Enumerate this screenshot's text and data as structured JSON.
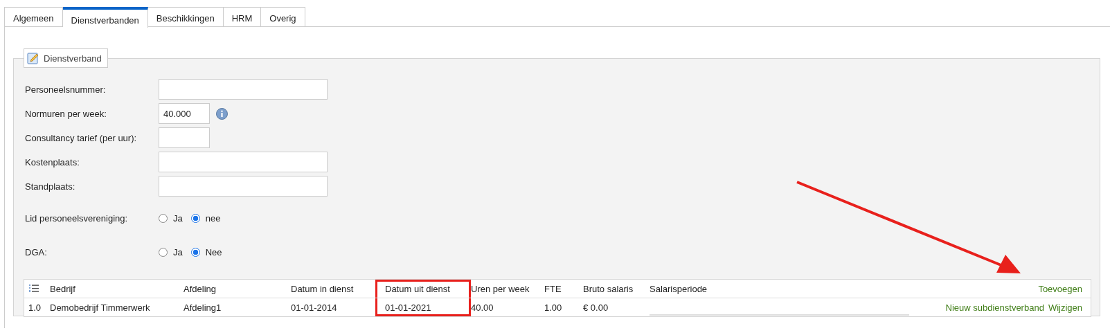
{
  "tabs": [
    {
      "label": "Algemeen",
      "selected": false
    },
    {
      "label": "Dienstverbanden",
      "selected": true
    },
    {
      "label": "Beschikkingen",
      "selected": false
    },
    {
      "label": "HRM",
      "selected": false
    },
    {
      "label": "Overig",
      "selected": false
    }
  ],
  "fieldset": {
    "legend": "Dienstverband",
    "fields": [
      {
        "kind": "wide",
        "label": "Personeelsnummer:"
      },
      {
        "kind": "narrow",
        "label": "Normuren per week:",
        "value": "40.000",
        "info": true
      },
      {
        "kind": "narrow",
        "label": "Consultancy tarief (per uur):"
      },
      {
        "kind": "wide",
        "label": "Kostenplaats:"
      },
      {
        "kind": "wide",
        "label": "Standplaats:"
      },
      {
        "kind": "radio",
        "label": "Lid personeelsvereniging:",
        "options": [
          {
            "label": "Ja",
            "selected": false
          },
          {
            "label": "nee",
            "selected": true
          }
        ]
      },
      {
        "kind": "radio",
        "label": "DGA:",
        "options": [
          {
            "label": "Ja",
            "selected": false
          },
          {
            "label": "Nee",
            "selected": true
          }
        ]
      }
    ]
  },
  "table": {
    "columns": [
      {
        "label": "Bedrijf",
        "highlighted": false
      },
      {
        "label": "Afdeling",
        "highlighted": false
      },
      {
        "label": "Datum in dienst",
        "highlighted": false
      },
      {
        "label": "Datum uit dienst",
        "highlighted": true
      },
      {
        "label": "Uren per week",
        "highlighted": false
      },
      {
        "label": "FTE",
        "highlighted": false
      },
      {
        "label": "Bruto salaris",
        "highlighted": false
      },
      {
        "label": "Salarisperiode",
        "highlighted": false
      }
    ],
    "add_link": "Toevoegen",
    "rows": [
      {
        "number": "1.0",
        "cells": [
          "Demobedrijf Timmerwerk",
          "Afdeling1",
          "01-01-2014",
          "01-01-2021",
          "40.00",
          "1.00",
          "€ 0.00",
          ""
        ],
        "links": [
          "Nieuw subdienstverband",
          "Wijzigen"
        ]
      }
    ]
  }
}
